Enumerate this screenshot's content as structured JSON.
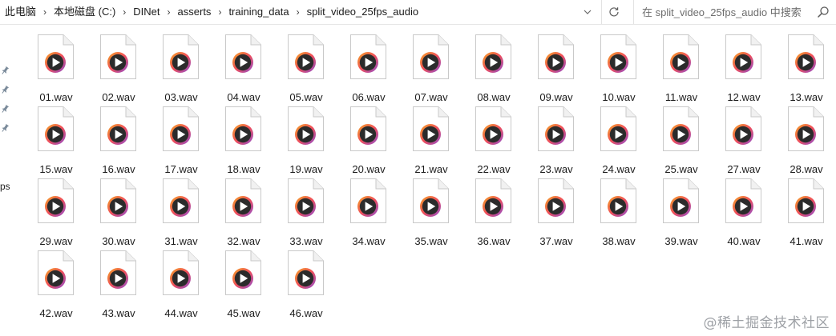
{
  "breadcrumb": [
    "此电脑",
    "本地磁盘 (C:)",
    "DINet",
    "asserts",
    "training_data",
    "split_video_25fps_audio"
  ],
  "breadcrumb_separator": "›",
  "search": {
    "placeholder": "在 split_video_25fps_audio 中搜索"
  },
  "icons": {
    "dropdown": "chevron-down-icon",
    "refresh": "refresh-icon",
    "search": "search-icon",
    "pin": "pin-icon",
    "file": "audio-play-file-icon"
  },
  "navigation": {
    "fragment_text": "ps"
  },
  "files": [
    "01.wav",
    "02.wav",
    "03.wav",
    "04.wav",
    "05.wav",
    "06.wav",
    "07.wav",
    "08.wav",
    "09.wav",
    "10.wav",
    "11.wav",
    "12.wav",
    "13.wav",
    "15.wav",
    "16.wav",
    "17.wav",
    "18.wav",
    "19.wav",
    "20.wav",
    "21.wav",
    "22.wav",
    "23.wav",
    "24.wav",
    "25.wav",
    "27.wav",
    "28.wav",
    "29.wav",
    "30.wav",
    "31.wav",
    "32.wav",
    "33.wav",
    "34.wav",
    "35.wav",
    "36.wav",
    "37.wav",
    "38.wav",
    "39.wav",
    "40.wav",
    "41.wav",
    "42.wav",
    "43.wav",
    "44.wav",
    "45.wav",
    "46.wav"
  ],
  "watermark": "@稀土掘金技术社区",
  "colors": {
    "ring_start": "#f5a524",
    "ring_mid": "#ef4e5a",
    "ring_end": "#8e4fd1",
    "play_disc": "#2b2b2b"
  }
}
